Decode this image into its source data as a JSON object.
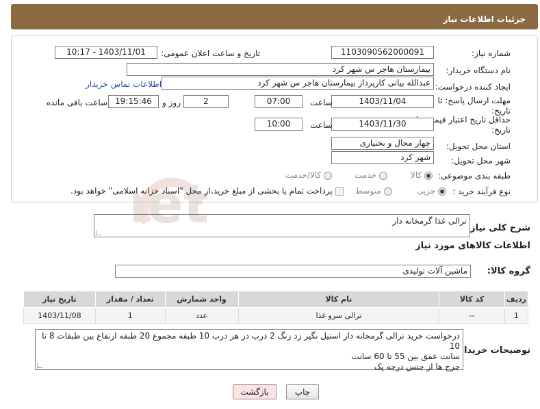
{
  "header": {
    "title": "جزئیات اطلاعات نیاز"
  },
  "form": {
    "need_number": {
      "label": "شماره نیاز:",
      "value": "1103090562000091"
    },
    "announce": {
      "label": "تاریخ و ساعت اعلان عمومی:",
      "value": "1403/11/01 - 10:17"
    },
    "buyer": {
      "label": "نام دستگاه خریدار:",
      "value": "بیمارستان هاجر س  شهر کرد"
    },
    "creator": {
      "label": "ایجاد کننده درخواست:",
      "value": "عبدالله بیاتی کارپرداز بیمارستان هاجر س  شهر کرد",
      "contact_link": "اطلاعات تماس خریدار"
    },
    "reply_deadline": {
      "label_1": "مهلت ارسال پاسخ: تا",
      "label_2": "تاریخ:",
      "date": "1403/11/04",
      "time_label": "ساعت",
      "time": "07:00",
      "days": "2",
      "days_label": "روز و",
      "remaining": "19:15:46",
      "remaining_label": "ساعت باقی مانده"
    },
    "price_deadline": {
      "label_1": "حداقل تاریخ اعتبار قیمت: تا",
      "label_2": "تاریخ:",
      "date": "1403/11/30",
      "time_label": "ساعت",
      "time": "10:00"
    },
    "province": {
      "label": "استان محل تحویل:",
      "value": "چهار محال و بختیاری"
    },
    "city": {
      "label": "شهر محل تحویل:",
      "value": "شهر کرد"
    },
    "category": {
      "label": "طبقه بندی موضوعی:",
      "options": [
        "کالا",
        "خدمت",
        "کالا/خدمت"
      ],
      "selected": "کالا"
    },
    "process": {
      "label": "نوع فرآیند خرید :",
      "options": [
        "جزیی",
        "متوسط"
      ],
      "selected": "جزیی",
      "payment_text": "پرداخت تمام یا بخشی از مبلغ خرید،از محل \"اسناد خزانه اسلامی\" خواهد بود."
    }
  },
  "summary": {
    "label": "شرح کلی نیاز:",
    "value": "ترالی غذا گرمخانه دار"
  },
  "goods_info": {
    "title": "اطلاعات کالاهای مورد نیاز"
  },
  "group": {
    "label": "گروه کالا:",
    "value": "ماشین آلات تولیدی"
  },
  "table": {
    "headers": [
      "ردیف",
      "کد کالا",
      "نام کالا",
      "واحد شمارش",
      "تعداد / مقدار",
      "تاریخ نیاز"
    ],
    "rows": [
      [
        "1",
        "--",
        "ترالی سرو غذا",
        "عدد",
        "1",
        "1403/11/08"
      ]
    ]
  },
  "buyer_notes": {
    "label": "توضیحات خریدار:",
    "lines": [
      "درخواست خرید ترالی گرمخانه دار استیل نگیر زد زنگ 2 درب در هر درب 10 طبقه مجموع 20 طبقه ارتفاع بین طبقات 8 تا 10",
      "سانت عمق بین 55 تا 60 سانت",
      "چرخ ها از جنس درجه یک"
    ]
  },
  "buttons": {
    "print": "چاپ",
    "back": "بازگشت"
  },
  "watermark": {
    "text": "AriaTender.net"
  },
  "colors": {
    "header_bg": "#8b6a41",
    "back_button_bg": "#fbe3e3",
    "link": "#2255aa"
  }
}
